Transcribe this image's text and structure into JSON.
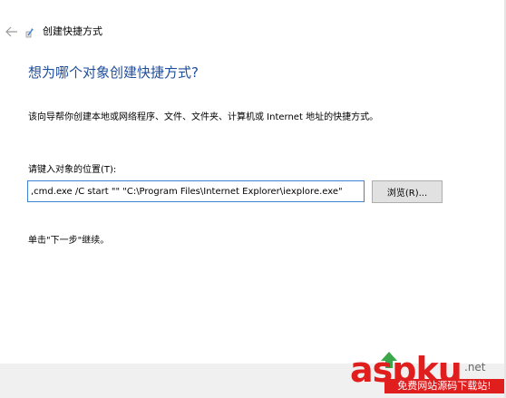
{
  "wizard": {
    "title": "创建快捷方式",
    "heading": "想为哪个对象创建快捷方式?",
    "description": "该向导帮你创建本地或网络程序、文件、文件夹、计算机或 Internet 地址的快捷方式。",
    "location_label": "请键入对象的位置(T):",
    "location_value": ",cmd.exe /C start \"\" \"C:\\Program Files\\Internet Explorer\\iexplore.exe\"",
    "browse_label": "浏览(R)...",
    "hint": "单击\"下一步\"继续。"
  },
  "watermark": {
    "logo": "aspku",
    "tld": ".net",
    "tagline": "免费网站源码下载站!"
  },
  "colors": {
    "heading": "#1f4e9b",
    "input_border": "#3c84d6",
    "watermark": "#e01e1e",
    "footer": "#f0f0f0"
  },
  "icons": {
    "back": "arrow-left-icon",
    "wizard": "shortcut-wizard-icon",
    "watermark_arrow": "arrow-up-icon"
  }
}
